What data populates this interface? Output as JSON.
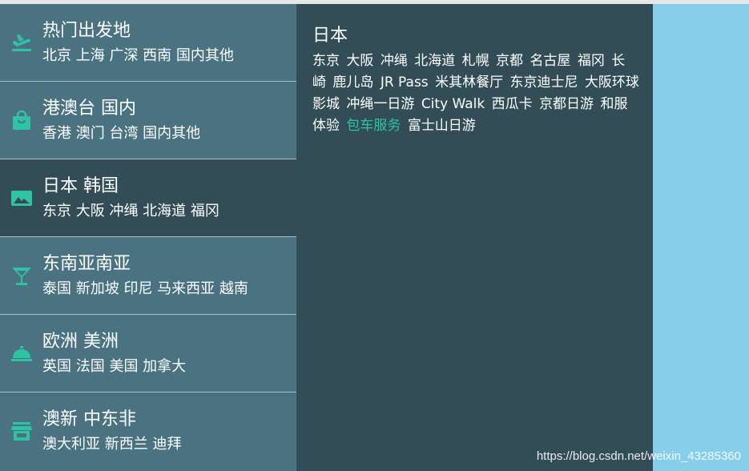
{
  "menu": {
    "items": [
      {
        "icon": "airplane-icon",
        "title": "热门出发地",
        "sub": "北京 上海 广深 西南 国内其他",
        "active": false
      },
      {
        "icon": "shopping-bag-icon",
        "title": "港澳台 国内",
        "sub": "香港 澳门 台湾 国内其他",
        "active": false
      },
      {
        "icon": "image-icon",
        "title": "日本 韩国",
        "sub": "东京 大阪 冲绳 北海道 福冈",
        "active": true
      },
      {
        "icon": "cocktail-icon",
        "title": "东南亚南亚",
        "sub": "泰国 新加坡 印尼 马来西亚 越南",
        "active": false
      },
      {
        "icon": "room-service-icon",
        "title": "欧洲 美洲",
        "sub": "英国 法国 美国 加拿大",
        "active": false
      },
      {
        "icon": "store-icon",
        "title": "澳新 中东非",
        "sub": "澳大利亚 新西兰 迪拜",
        "active": false
      }
    ]
  },
  "panel": {
    "title": "日本",
    "links": [
      {
        "label": "东京",
        "highlight": false
      },
      {
        "label": "大阪",
        "highlight": false
      },
      {
        "label": "冲绳",
        "highlight": false
      },
      {
        "label": "北海道",
        "highlight": false
      },
      {
        "label": "札幌",
        "highlight": false
      },
      {
        "label": "京都",
        "highlight": false
      },
      {
        "label": "名古屋",
        "highlight": false
      },
      {
        "label": "福冈",
        "highlight": false
      },
      {
        "label": "长崎",
        "highlight": false
      },
      {
        "label": "鹿儿岛",
        "highlight": false
      },
      {
        "label": "JR Pass",
        "highlight": false
      },
      {
        "label": "米其林餐厅",
        "highlight": false
      },
      {
        "label": "东京迪士尼",
        "highlight": false
      },
      {
        "label": "大阪环球影城",
        "highlight": false
      },
      {
        "label": "冲绳一日游",
        "highlight": false
      },
      {
        "label": "City Walk",
        "highlight": false
      },
      {
        "label": "西瓜卡",
        "highlight": false
      },
      {
        "label": "京都日游",
        "highlight": false
      },
      {
        "label": "和服体验",
        "highlight": false
      },
      {
        "label": "包车服务",
        "highlight": true
      },
      {
        "label": "富士山日游",
        "highlight": false
      }
    ]
  },
  "colors": {
    "menu_bg": "#4a7280",
    "active_bg": "#324d56",
    "icon_accent": "#2ec4a3",
    "right_bg": "#87ceeb"
  },
  "watermark": "https://blog.csdn.net/weixin_43285360"
}
